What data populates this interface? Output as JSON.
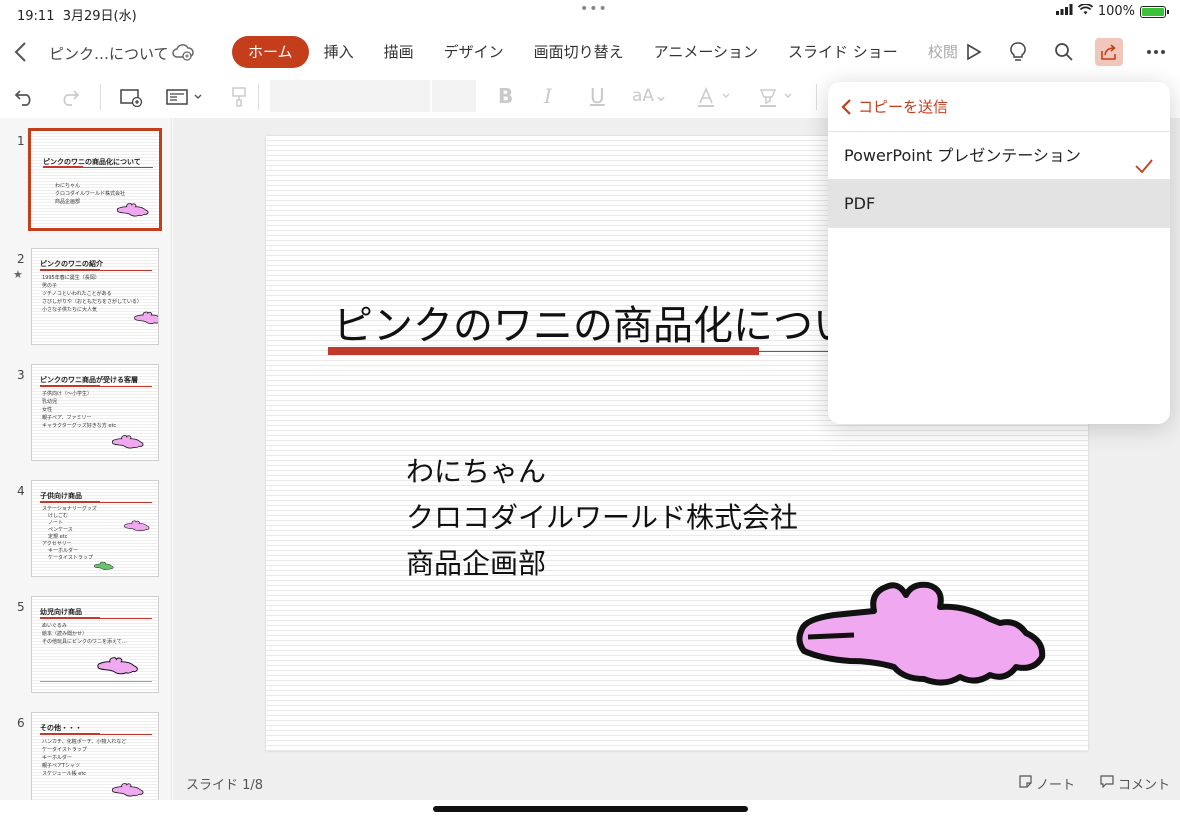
{
  "status": {
    "time": "19:11",
    "date": "3月29日(水)",
    "battery": "100%"
  },
  "header": {
    "doc_title": "ピンク…について",
    "tabs": [
      "ホーム",
      "挿入",
      "描画",
      "デザイン",
      "画面切り替え",
      "アニメーション",
      "スライド ショー",
      "校閲"
    ]
  },
  "sidebar": {
    "slides": [
      {
        "num": "1",
        "title": "ピンクのワニの商品化について",
        "bullets": [
          "わにちゃん",
          "クロコダイルワールド株式会社",
          "商品企画部"
        ]
      },
      {
        "num": "2",
        "title": "ピンクのワニの紹介",
        "bullets": [
          "1995年春に誕生（長岡）",
          "男の子",
          "ツチノコといわれたことがある",
          "さびしがりや（おともだちをさがしている）",
          "小さな子供たちに大人気"
        ]
      },
      {
        "num": "3",
        "title": "ピンクのワニ商品が受ける客層",
        "bullets": [
          "子供向け（〜小学生）",
          "乳幼児",
          "女性",
          "親子ペア、ファミリー",
          "キャラクターグッズ好きな方 etc"
        ]
      },
      {
        "num": "4",
        "title": "子供向け商品",
        "bullets": [
          "ステーショナリーグッズ",
          "けしごむ",
          "ノート",
          "ペンケース",
          "定規 etc",
          "アクセサリー",
          "キーホルダー",
          "ケータイストラップ"
        ]
      },
      {
        "num": "5",
        "title": "幼児向け商品",
        "bullets": [
          "ぬいぐるみ",
          "絵本（読み聞かせ）",
          "その他玩具にピンクのワニを添えて…"
        ]
      },
      {
        "num": "6",
        "title": "その他・・・",
        "bullets": [
          "ハンカチ、化粧ポーチ、小物入れなど",
          "ケータイストラップ",
          "キーホルダー",
          "親子ペアTシャツ",
          "スケジュール帳 etc"
        ]
      }
    ]
  },
  "slide": {
    "title": "ピンクのワニの商品化について",
    "subtitle_lines": [
      "わにちゃん",
      "クロコダイルワールド株式会社",
      "商品企画部"
    ]
  },
  "bottom": {
    "slide_info": "スライド 1/8",
    "note_label": "ノート",
    "comment_label": "コメント"
  },
  "popover": {
    "back_label": "コピーを送信",
    "items": [
      "PowerPoint プレゼンテーション",
      "PDF"
    ]
  },
  "colors": {
    "accent": "#c43e1c",
    "croc_pink": "#f0a8f0"
  }
}
